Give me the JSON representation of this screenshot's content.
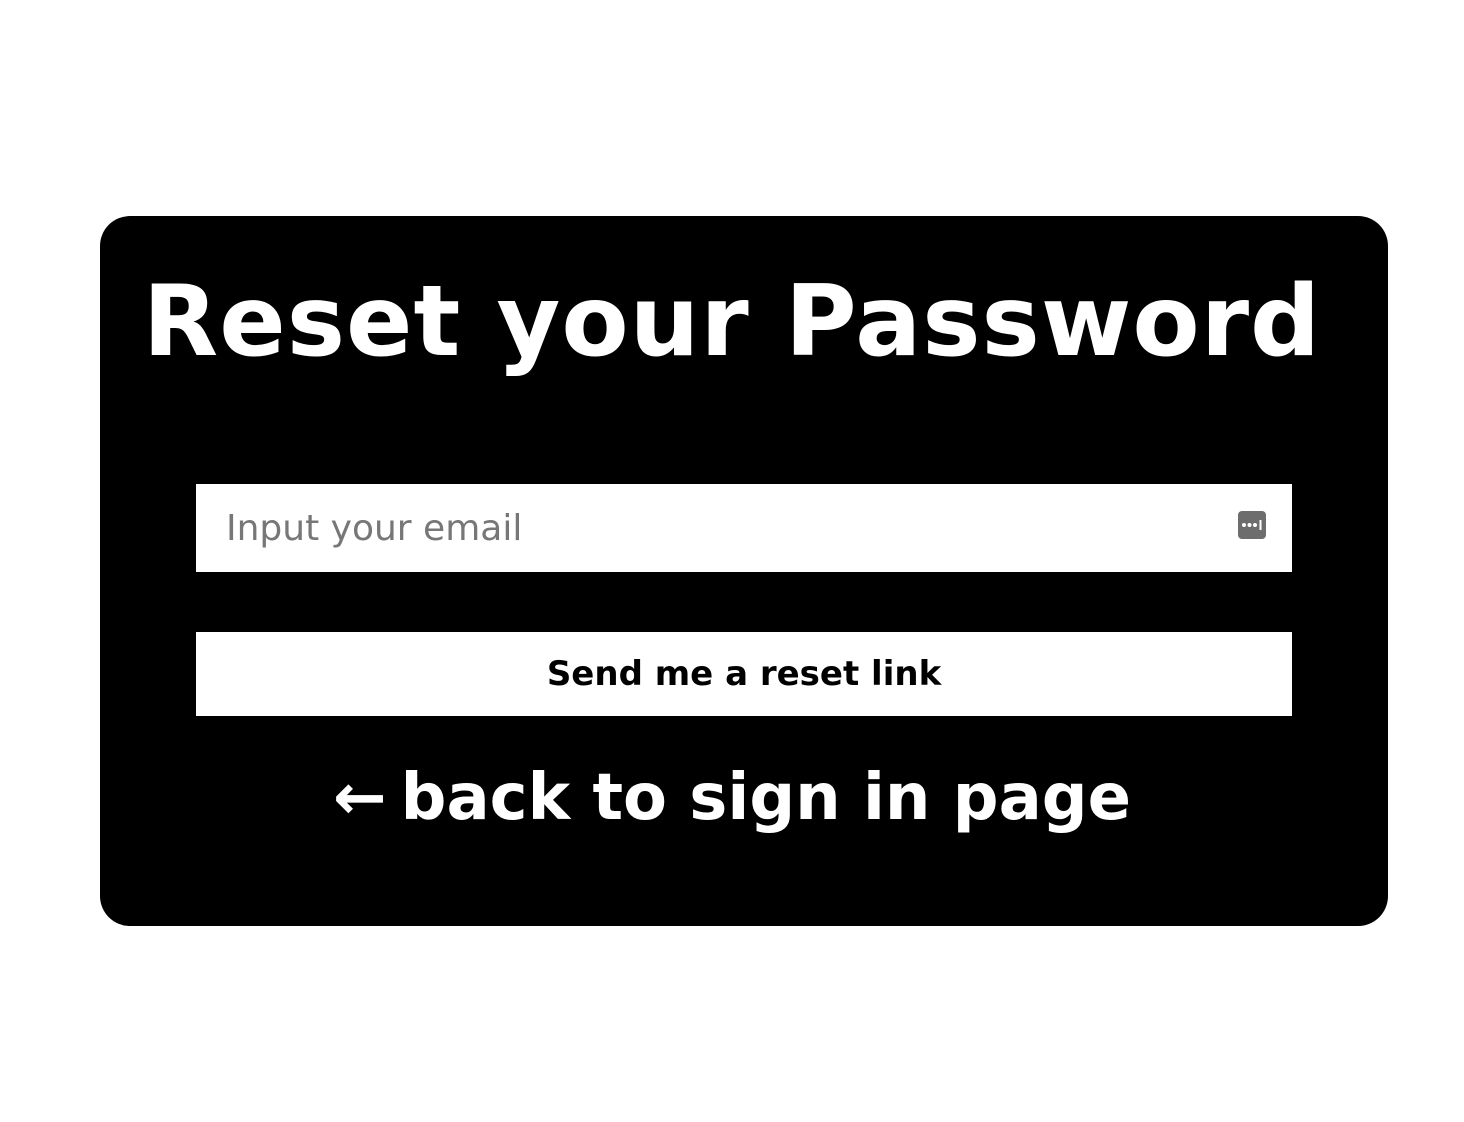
{
  "page": {
    "background": "#ffffff",
    "card_color": "#000000",
    "accent": "#ffffff"
  },
  "reset_card": {
    "title": "Reset your Password",
    "email_input": {
      "placeholder": "Input your email",
      "value": ""
    },
    "autofill_icon": "password-manager-icon",
    "submit_label": "Send me a reset link",
    "back_link": {
      "arrow": "←",
      "label": "back to sign in page"
    }
  }
}
